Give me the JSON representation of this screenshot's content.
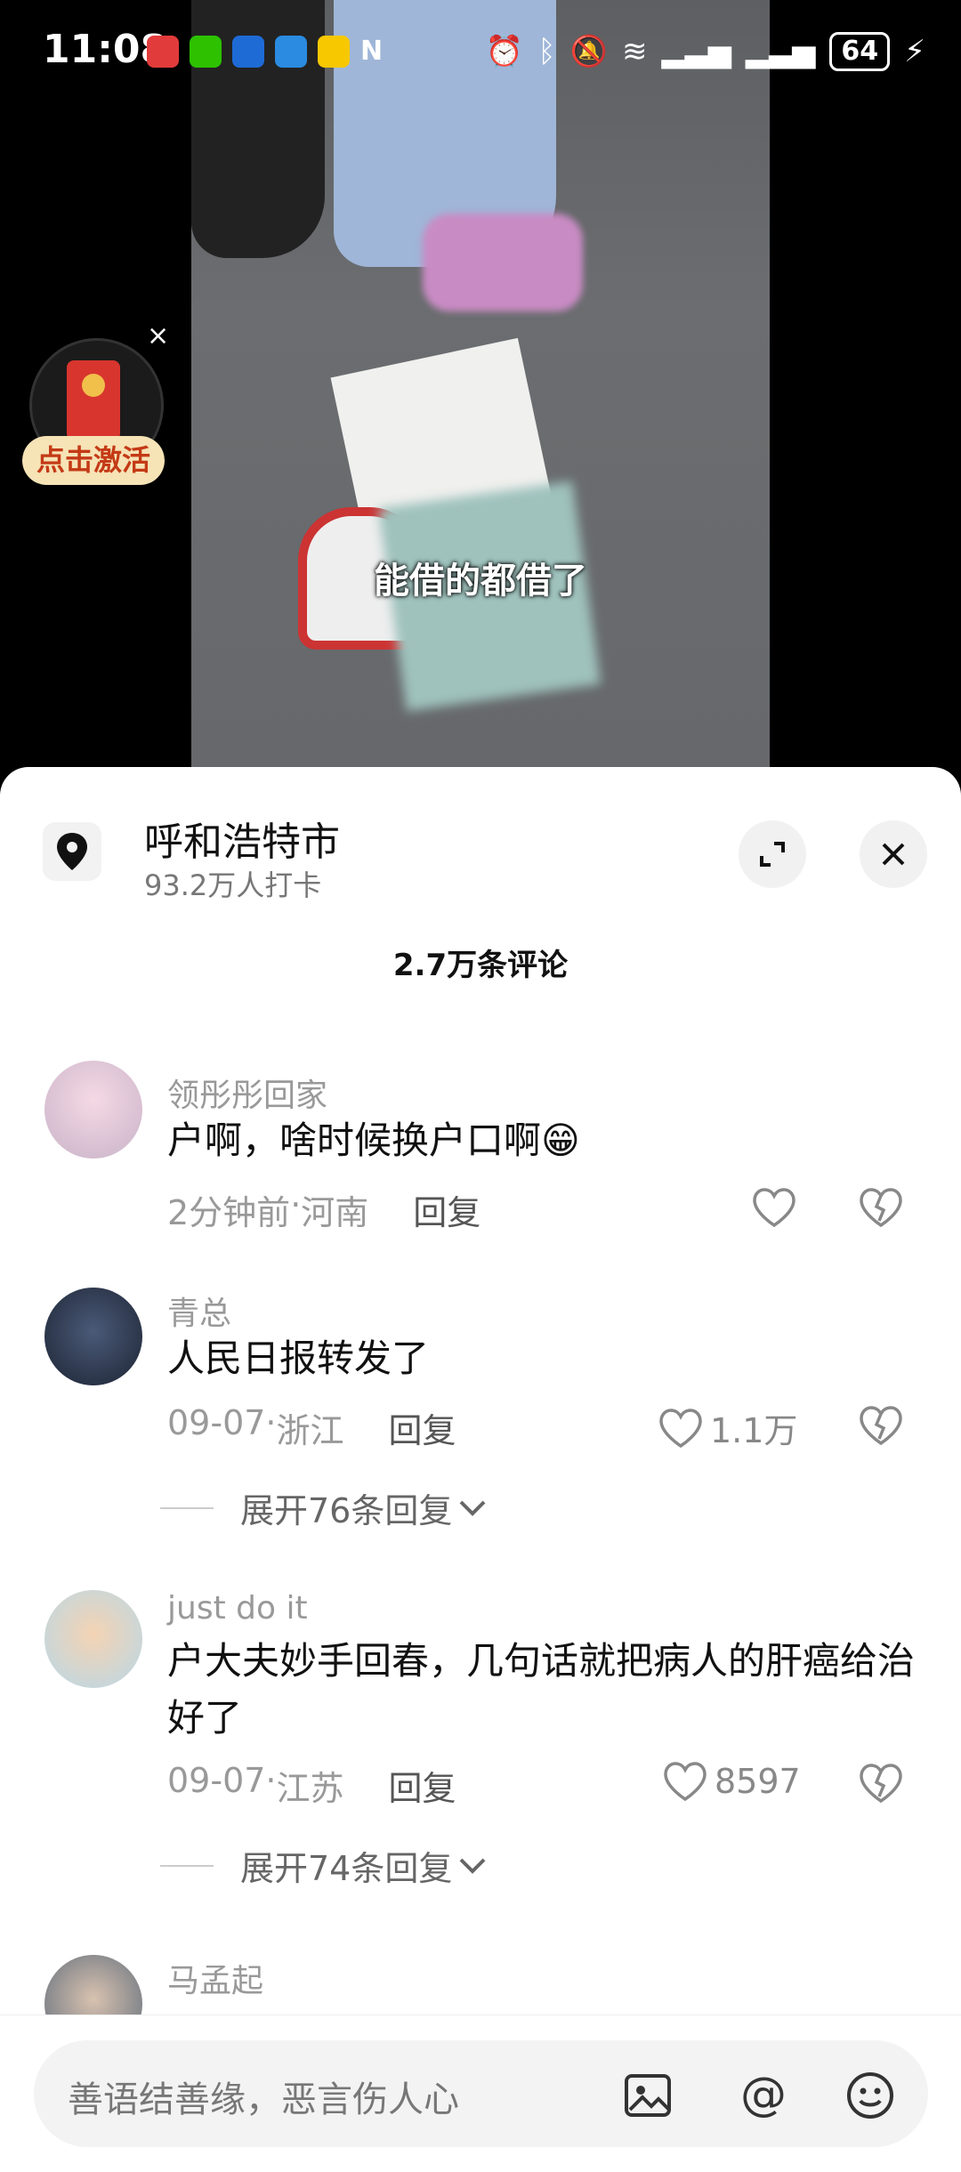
{
  "status_bar": {
    "time": "11:08",
    "battery": "64"
  },
  "video": {
    "subtitle": "能借的都借了"
  },
  "red_packet": {
    "label": "点击激活",
    "close": "×"
  },
  "location": {
    "title": "呼和浩特市",
    "checkins": "93.2万人打卡"
  },
  "comments_header": {
    "count": "2.7万条评论"
  },
  "comments": [
    {
      "user": "领彤彤回家",
      "text": "户啊，啥时候换户口啊😁",
      "time": "2分钟前",
      "region": "河南",
      "reply": "回复",
      "likes": ""
    },
    {
      "user": "青总",
      "text": "人民日报转发了",
      "time": "09-07",
      "region": "浙江",
      "reply": "回复",
      "likes": "1.1万",
      "expand": "展开76条回复"
    },
    {
      "user": "just do it",
      "text": "户大夫妙手回春，几句话就把病人的肝癌给治好了",
      "time": "09-07",
      "region": "江苏",
      "reply": "回复",
      "likes": "8597",
      "expand": "展开74条回复"
    },
    {
      "user": "马孟起"
    }
  ],
  "input_bar": {
    "placeholder": "善语结善缘，恶言伤人心"
  },
  "colors": {
    "accent_red": "#d8352f",
    "badge_bg": "#f6e3b6"
  }
}
